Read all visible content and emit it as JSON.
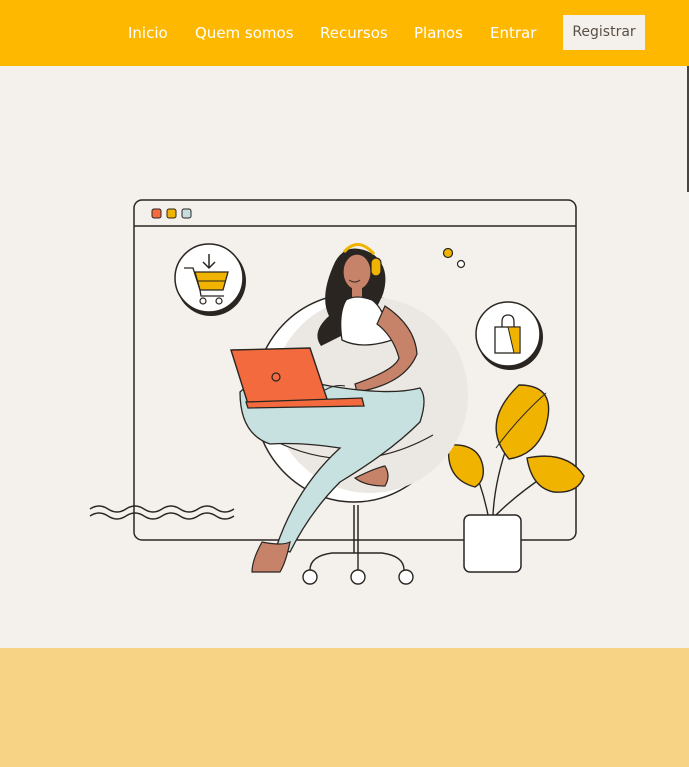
{
  "nav": {
    "links": [
      "Inicio",
      "Quem somos",
      "Recursos",
      "Planos",
      "Entrar"
    ],
    "register_label": "Registrar"
  },
  "colors": {
    "brand_yellow": "#ffb800",
    "page_background": "#f4f1ed",
    "footer_band": "#f7d385",
    "laptop_orange": "#f26a3d",
    "plant_yellow": "#f0b400"
  },
  "illustration": {
    "subject": "woman-with-headphones-using-laptop-on-egg-chair-in-browser-window",
    "icons": [
      "download-cart-icon",
      "shopping-bag-icon",
      "plant-icon"
    ]
  }
}
